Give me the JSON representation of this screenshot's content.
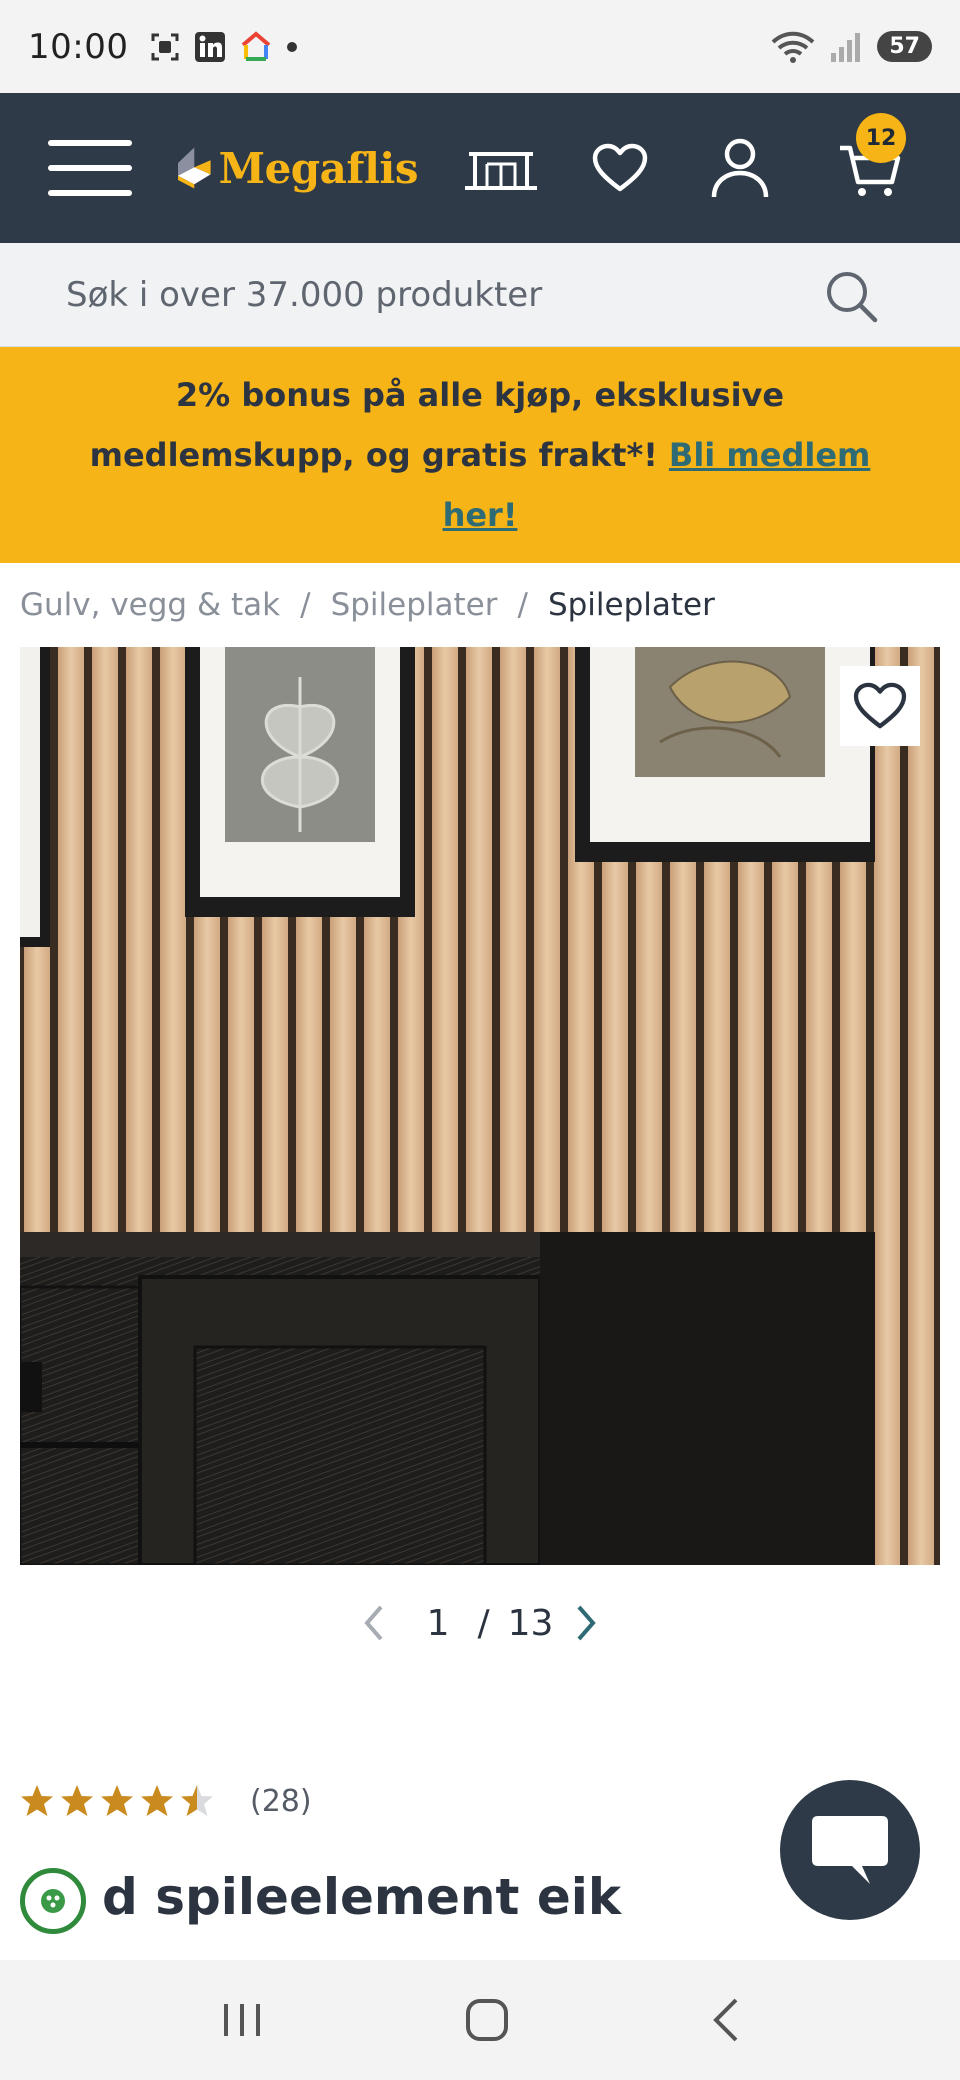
{
  "status_bar": {
    "time": "10:00",
    "battery": "57",
    "notif_icons": [
      "screenshot-icon",
      "linkedin-icon",
      "google-home-icon",
      "dot-icon"
    ],
    "system_icons": [
      "wifi-icon",
      "signal-icon",
      "battery-icon"
    ]
  },
  "header": {
    "logo_text": "Megaflis",
    "cart_count": "12",
    "icons": [
      "menu-icon",
      "showroom-icon",
      "heart-icon",
      "user-icon",
      "cart-icon"
    ]
  },
  "search": {
    "placeholder": "Søk i over 37.000 produkter"
  },
  "promo": {
    "text": "2% bonus på alle kjøp, eksklusive medlemskupp, og gratis frakt*! ",
    "link_text": "Bli medlem her!"
  },
  "breadcrumb": {
    "items": [
      "Gulv, vegg & tak",
      "Spileplater",
      "Spileplater"
    ],
    "separator": "/"
  },
  "gallery": {
    "current": "1",
    "separator": "/",
    "total": "13"
  },
  "product": {
    "rating": 4.5,
    "rating_count": "(28)",
    "title": "d spileelement eik"
  },
  "colors": {
    "nav_bg": "#2e3a47",
    "brand_yellow": "#f7b417",
    "link_teal": "#2e6b74",
    "star": "#c98a1f"
  }
}
